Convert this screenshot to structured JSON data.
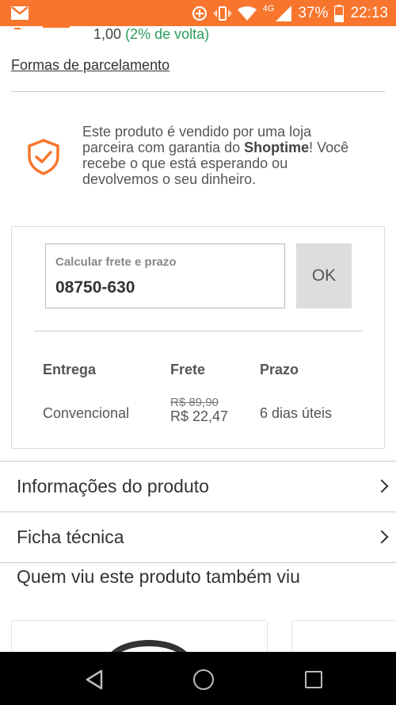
{
  "status_bar": {
    "network": "4G",
    "battery": "37%",
    "time": "22:13"
  },
  "cashback": {
    "amount": "1,00",
    "percent_text": "(2% de volta)"
  },
  "installments_link": "Formas de parcelamento",
  "guarantee": {
    "text_before": "Este produto é vendido por uma loja parceira com garantia do ",
    "brand": "Shoptime",
    "text_after": "! Você recebe o que está esperando ou devolvemos o seu dinheiro."
  },
  "shipping": {
    "cep_label": "Calcular frete e prazo",
    "cep_value": "08750-630",
    "ok_label": "OK",
    "headers": {
      "delivery": "Entrega",
      "freight": "Frete",
      "deadline": "Prazo"
    },
    "rows": [
      {
        "delivery": "Convencional",
        "old_price": "R$ 89,90",
        "price": "R$ 22,47",
        "deadline": "6 dias úteis"
      }
    ]
  },
  "sections": {
    "product_info": "Informações do produto",
    "tech_sheet": "Ficha técnica"
  },
  "related": {
    "title": "Quem viu este produto também viu"
  },
  "colors": {
    "status_bar": "#f7752d",
    "cashback_green": "#2a9d5a",
    "shield": "#f7752d"
  }
}
